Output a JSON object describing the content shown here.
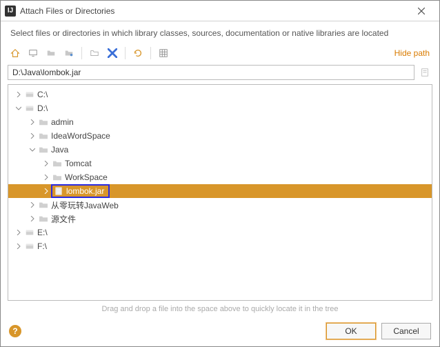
{
  "window": {
    "title": "Attach Files or Directories"
  },
  "subtitle": "Select files or directories in which library classes, sources, documentation or native libraries are located",
  "hide_path": "Hide path",
  "path_value": "D:\\Java\\lombok.jar",
  "tree": {
    "c": "C:\\",
    "d": "D:\\",
    "admin": "admin",
    "ideawordspace": "IdeaWordSpace",
    "java": "Java",
    "tomcat": "Tomcat",
    "workspace": "WorkSpace",
    "lombok": "lombok.jar",
    "cn1": "从零玩转JavaWeb",
    "cn2": "源文件",
    "e": "E:\\",
    "f": "F:\\"
  },
  "hint": "Drag and drop a file into the space above to quickly locate it in the tree",
  "buttons": {
    "ok": "OK",
    "cancel": "Cancel"
  },
  "help": "?"
}
